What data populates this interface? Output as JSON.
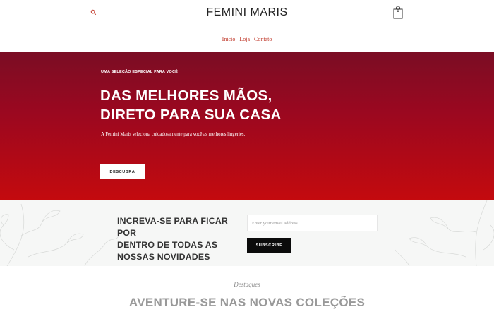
{
  "header": {
    "brand": "FEMINI MARIS",
    "cart_count": "0",
    "nav": [
      "Início",
      "Loja",
      "Contato"
    ]
  },
  "hero": {
    "eyebrow": "UMA SELEÇÃO ESPECIAL PARA VOCÊ",
    "title_line1": "DAS MELHORES MÃOS,",
    "title_line2": "DIRETO PARA SUA CASA",
    "subtitle": "A Femini Maris seleciona cuidadosamente para você as melhores lingeries.",
    "button_label": "DESCUBRA"
  },
  "newsletter": {
    "title_line1": "INCREVA-SE PARA FICAR POR",
    "title_line2": "DENTRO DE TODAS AS",
    "title_line3": "NOSSAS NOVIDADES",
    "email_placeholder": "Enter your email address",
    "button_label": "SUBSCRIBE"
  },
  "featured": {
    "eyebrow": "Destaques",
    "title": "AVENTURE-SE NAS NOVAS COLEÇÕES"
  },
  "colors": {
    "accent": "#c0392b",
    "hero_top": "#7a0d24",
    "hero_bottom": "#c40a0e"
  }
}
